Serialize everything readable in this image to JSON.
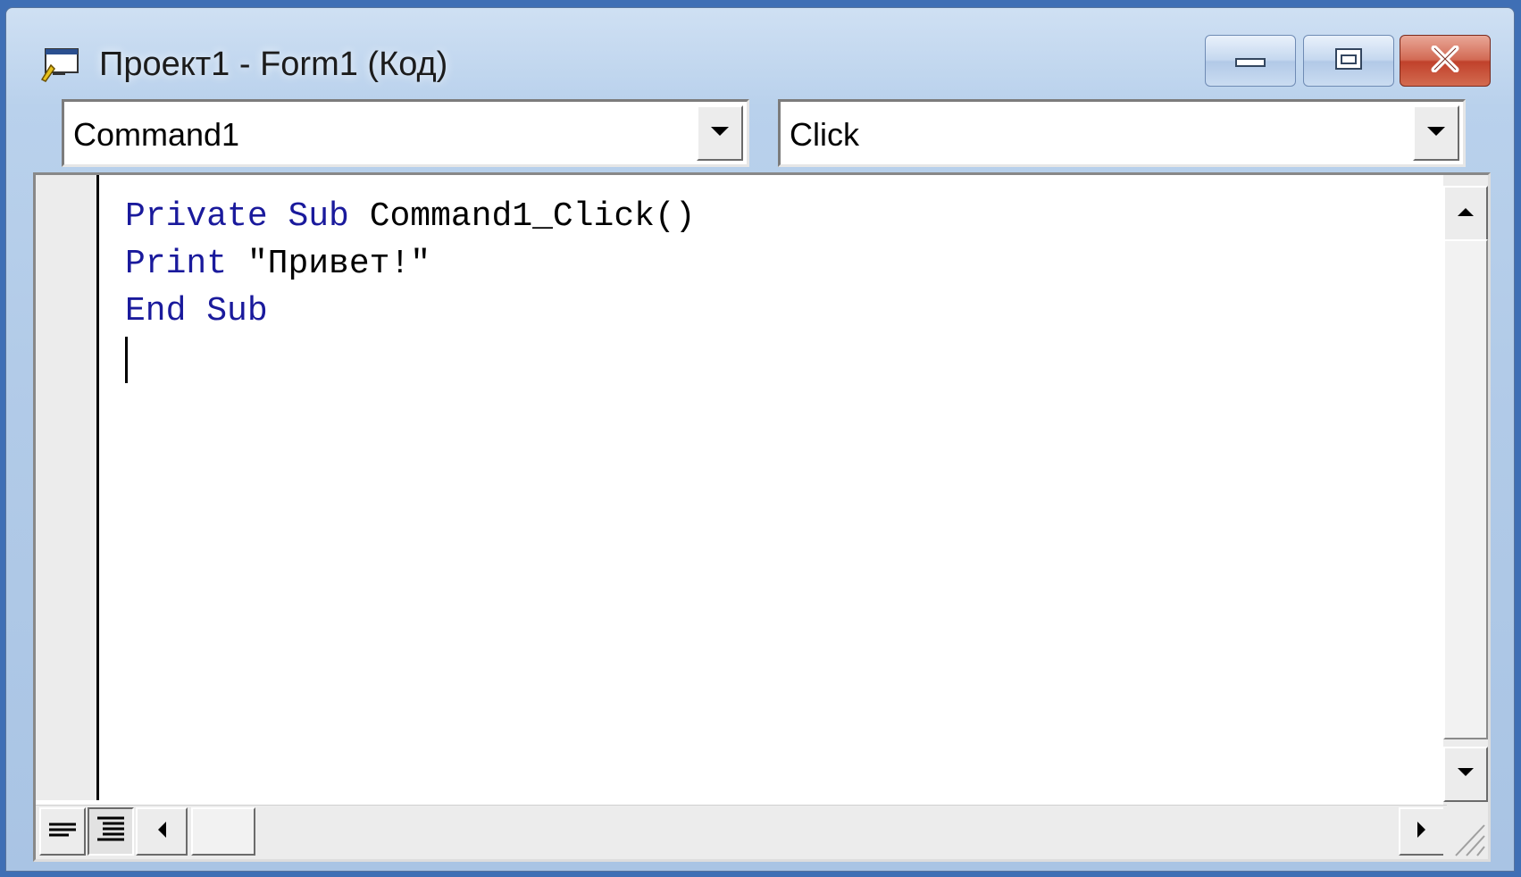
{
  "window": {
    "title": "Проект1 - Form1 (Код)"
  },
  "toolbar": {
    "object_combo_value": "Command1",
    "procedure_combo_value": "Click"
  },
  "editor": {
    "lines": [
      {
        "keyword1": "Private",
        "keyword2": "Sub",
        "rest": "Command1_Click()"
      },
      {
        "keyword1": "Print",
        "rest": "\"Привет!\""
      },
      {
        "keyword1": "End",
        "keyword2": "Sub"
      }
    ]
  },
  "colors": {
    "keyword": "#1a1a9c",
    "close_button": "#c0412b"
  },
  "icons": [
    "form-code-icon",
    "minimize-icon",
    "maximize-icon",
    "close-icon",
    "dropdown-arrow-icon",
    "scroll-up-icon",
    "scroll-down-icon",
    "scroll-left-icon",
    "scroll-right-icon",
    "procedure-view-icon",
    "full-module-view-icon",
    "resize-grip-icon"
  ]
}
